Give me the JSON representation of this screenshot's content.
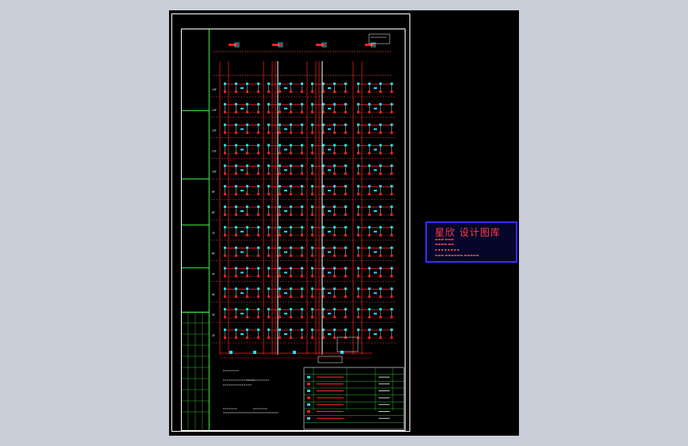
{
  "drawing": {
    "floors": [
      "14F",
      "13F",
      "12F",
      "11F",
      "10F",
      "9F",
      "8F",
      "7F",
      "6F",
      "5F",
      "4F",
      "3F",
      "2F"
    ],
    "column_count": 4,
    "colors": {
      "background": "#000000",
      "frame": "#ffffff",
      "title_block": "#3ee43e",
      "riser": "#ff2020",
      "device": "#23e0ff",
      "floor_line": "#ff6060"
    }
  },
  "watermark": {
    "title": "星欣 设计图库",
    "color_border": "#3a2bff",
    "color_text": "#ff4040"
  },
  "legend": {
    "rows": 7
  }
}
